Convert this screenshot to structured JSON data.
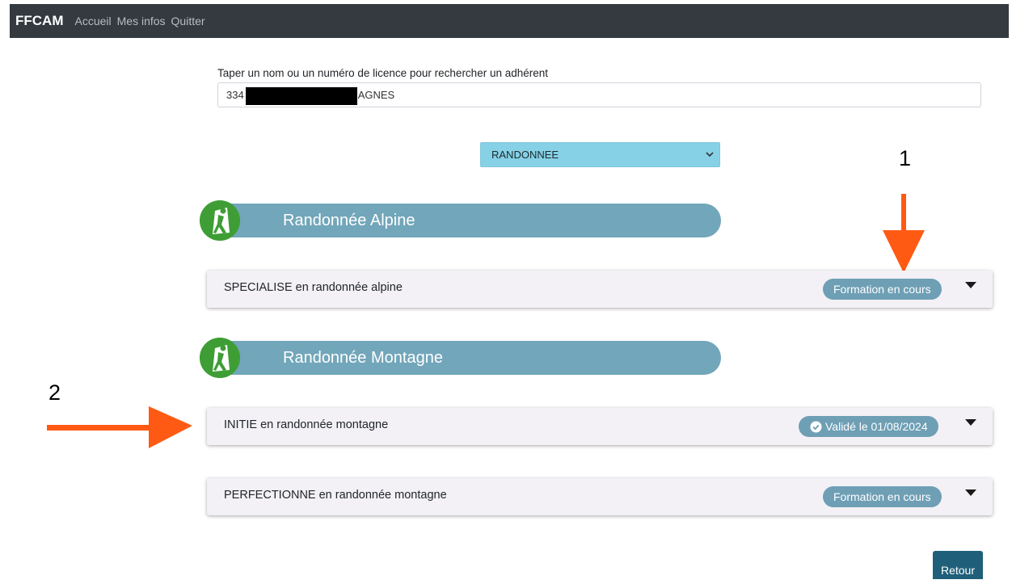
{
  "navbar": {
    "brand": "FFCAM",
    "links": [
      "Accueil",
      "Mes infos",
      "Quitter"
    ]
  },
  "search": {
    "label": "Taper un nom ou un numéro de licence pour rechercher un adhérent",
    "value_prefix": "334",
    "value_suffix": "AGNES"
  },
  "activity_select": {
    "value": "RANDONNEE"
  },
  "sections": [
    {
      "title": "Randonnée Alpine",
      "items": [
        {
          "label": "SPECIALISE en randonnée alpine",
          "status": "Formation en cours",
          "validated": false
        }
      ]
    },
    {
      "title": "Randonnée Montagne",
      "items": [
        {
          "label": "INITIE en randonnée montagne",
          "status": "Validé le 01/08/2024",
          "validated": true
        },
        {
          "label": "PERFECTIONNE en randonnée montagne",
          "status": "Formation en cours",
          "validated": false
        }
      ]
    }
  ],
  "annotations": {
    "one": "1",
    "two": "2"
  },
  "retour_label": "Retour",
  "colors": {
    "navbar": "#343a40",
    "section_bar": "#72a6ba",
    "section_icon": "#3e9e35",
    "badge": "#6e9fb5",
    "select": "#86d1e5",
    "annotation_arrow": "#ff5a14",
    "retour_button": "#1f5f7a"
  },
  "icons": [
    "hiker-icon",
    "check-circle-icon",
    "caret-down-icon",
    "chevron-down-icon",
    "arrow-down-icon",
    "arrow-right-icon"
  ]
}
